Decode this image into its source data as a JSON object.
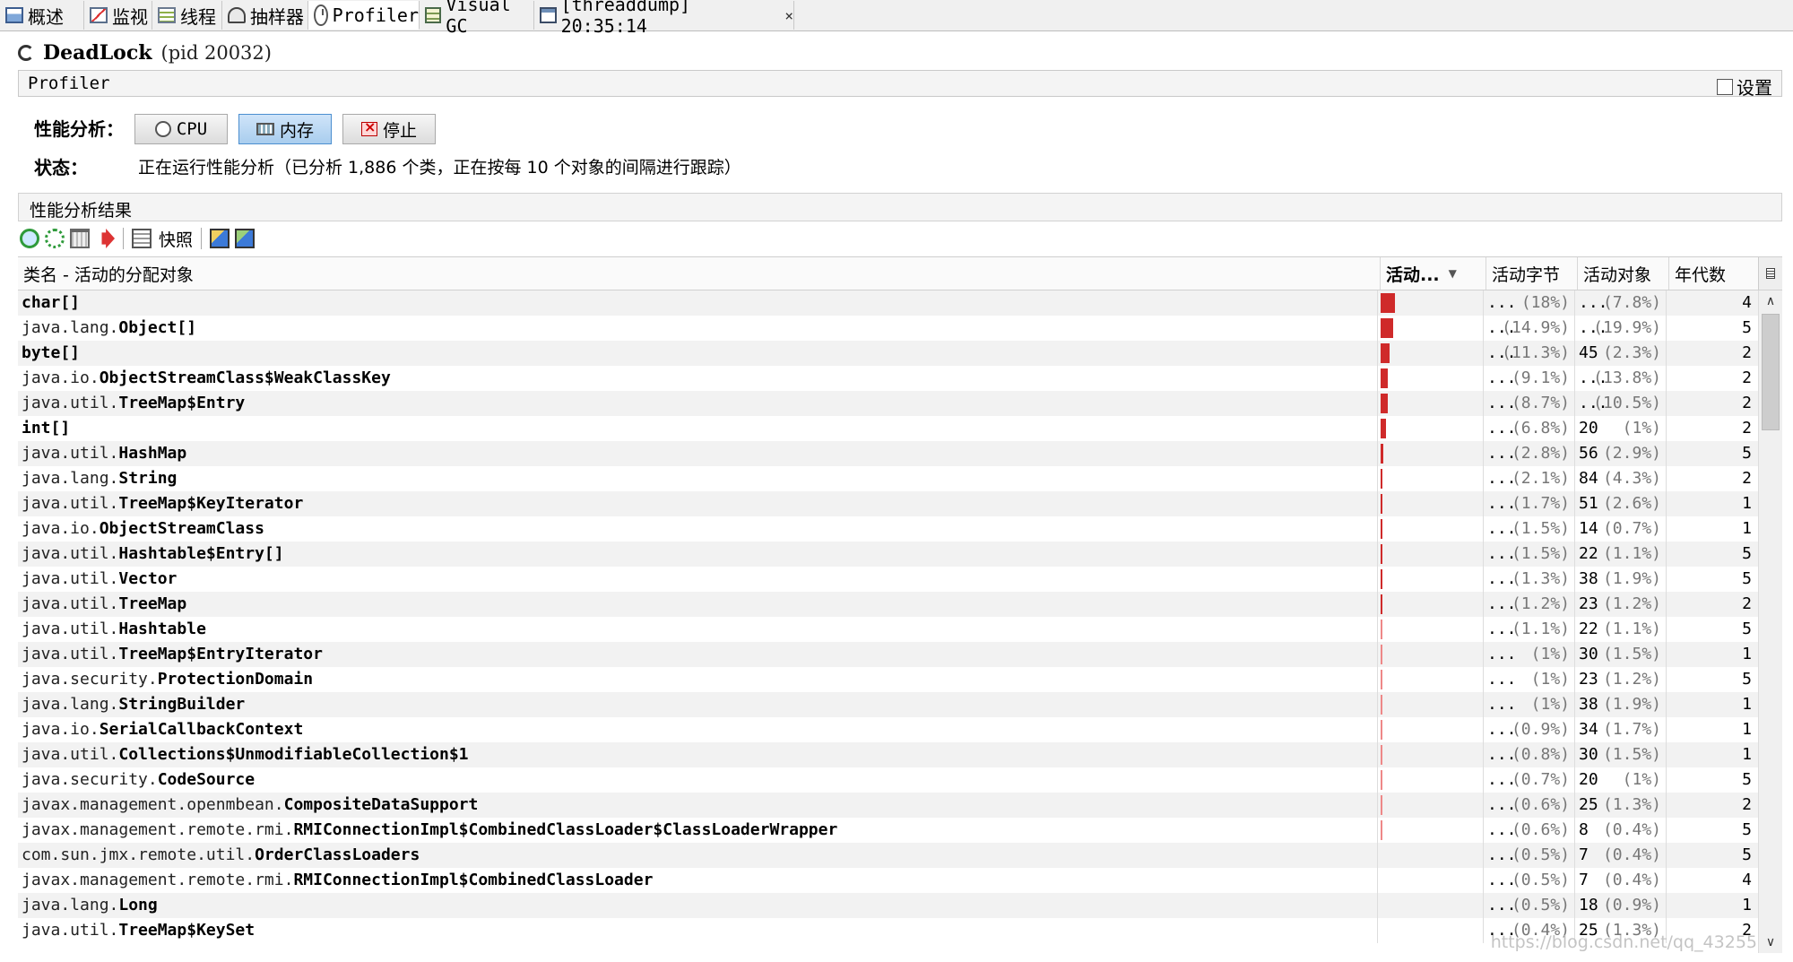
{
  "tabs": [
    {
      "label": "概述",
      "icon": "overview-icon"
    },
    {
      "label": "监视",
      "icon": "monitor-icon"
    },
    {
      "label": "线程",
      "icon": "threads-icon"
    },
    {
      "label": "抽样器",
      "icon": "sampler-icon"
    },
    {
      "label": "Profiler",
      "icon": "profiler-icon",
      "active": true
    },
    {
      "label": "Visual GC",
      "icon": "visual-gc-icon"
    },
    {
      "label": "[threaddump] 20:35:14",
      "icon": "threaddump-icon"
    }
  ],
  "tab_close": "×",
  "app": {
    "name": "DeadLock",
    "pid": "(pid 20032)"
  },
  "profiler_header": {
    "label": "Profiler",
    "settings_label": "设置"
  },
  "controls": {
    "perf_label": "性能分析：",
    "cpu_label": "CPU",
    "memory_label": "内存",
    "stop_label": "停止",
    "status_label": "状态：",
    "status_text": "正在运行性能分析（已分析 1,886 个类，正在按每 10 个对象的间隔进行跟踪）"
  },
  "results": {
    "label": "性能分析结果",
    "snapshot_label": "快照"
  },
  "table": {
    "headers": {
      "name": "类名 - 活动的分配对象",
      "live": "活动...",
      "live_bytes": "活动字节",
      "live_objects": "活动对象",
      "generations": "年代数"
    },
    "rows": [
      {
        "pkg": "",
        "cls": "char[]",
        "bar": 0.148,
        "bytes": "...",
        "bytes_pct": "(18%)",
        "objs": "...",
        "objs_pct": "(7.8%)",
        "gen": "4"
      },
      {
        "pkg": "java.lang.",
        "cls": "Object[]",
        "bar": 0.123,
        "bytes": "...",
        "bytes_pct": "(14.9%)",
        "objs": "...",
        "objs_pct": "(19.9%)",
        "gen": "5"
      },
      {
        "pkg": "",
        "cls": "byte[]",
        "bar": 0.093,
        "bytes": "...",
        "bytes_pct": "(11.3%)",
        "objs": "45",
        "objs_pct": "(2.3%)",
        "gen": "2"
      },
      {
        "pkg": "java.io.",
        "cls": "ObjectStreamClass$WeakClassKey",
        "bar": 0.075,
        "bytes": "...",
        "bytes_pct": "(9.1%)",
        "objs": "...",
        "objs_pct": "(13.8%)",
        "gen": "2"
      },
      {
        "pkg": "java.util.",
        "cls": "TreeMap$Entry",
        "bar": 0.072,
        "bytes": "...",
        "bytes_pct": "(8.7%)",
        "objs": "...",
        "objs_pct": "(10.5%)",
        "gen": "2"
      },
      {
        "pkg": "",
        "cls": "int[]",
        "bar": 0.056,
        "bytes": "...",
        "bytes_pct": "(6.8%)",
        "objs": "20",
        "objs_pct": "(1%)",
        "gen": "2"
      },
      {
        "pkg": "java.util.",
        "cls": "HashMap",
        "bar": 0.023,
        "bytes": "...",
        "bytes_pct": "(2.8%)",
        "objs": "56",
        "objs_pct": "(2.9%)",
        "gen": "5"
      },
      {
        "pkg": "java.lang.",
        "cls": "String",
        "bar": 0.017,
        "bytes": "...",
        "bytes_pct": "(2.1%)",
        "objs": "84",
        "objs_pct": "(4.3%)",
        "gen": "2"
      },
      {
        "pkg": "java.util.",
        "cls": "TreeMap$KeyIterator",
        "bar": 0.014,
        "bytes": "...",
        "bytes_pct": "(1.7%)",
        "objs": "51",
        "objs_pct": "(2.6%)",
        "gen": "1"
      },
      {
        "pkg": "java.io.",
        "cls": "ObjectStreamClass",
        "bar": 0.012,
        "bytes": "...",
        "bytes_pct": "(1.5%)",
        "objs": "14",
        "objs_pct": "(0.7%)",
        "gen": "1"
      },
      {
        "pkg": "java.util.",
        "cls": "Hashtable$Entry[]",
        "bar": 0.012,
        "bytes": "...",
        "bytes_pct": "(1.5%)",
        "objs": "22",
        "objs_pct": "(1.1%)",
        "gen": "5"
      },
      {
        "pkg": "java.util.",
        "cls": "Vector",
        "bar": 0.011,
        "bytes": "...",
        "bytes_pct": "(1.3%)",
        "objs": "38",
        "objs_pct": "(1.9%)",
        "gen": "5"
      },
      {
        "pkg": "java.util.",
        "cls": "TreeMap",
        "bar": 0.01,
        "bytes": "...",
        "bytes_pct": "(1.2%)",
        "objs": "23",
        "objs_pct": "(1.2%)",
        "gen": "2"
      },
      {
        "pkg": "java.util.",
        "cls": "Hashtable",
        "bar": 0.009,
        "bytes": "...",
        "bytes_pct": "(1.1%)",
        "objs": "22",
        "objs_pct": "(1.1%)",
        "gen": "5"
      },
      {
        "pkg": "java.util.",
        "cls": "TreeMap$EntryIterator",
        "bar": 0.008,
        "bytes": "...",
        "bytes_pct": "(1%)",
        "objs": "30",
        "objs_pct": "(1.5%)",
        "gen": "1"
      },
      {
        "pkg": "java.security.",
        "cls": "ProtectionDomain",
        "bar": 0.008,
        "bytes": "...",
        "bytes_pct": "(1%)",
        "objs": "23",
        "objs_pct": "(1.2%)",
        "gen": "5"
      },
      {
        "pkg": "java.lang.",
        "cls": "StringBuilder",
        "bar": 0.008,
        "bytes": "...",
        "bytes_pct": "(1%)",
        "objs": "38",
        "objs_pct": "(1.9%)",
        "gen": "1"
      },
      {
        "pkg": "java.io.",
        "cls": "SerialCallbackContext",
        "bar": 0.007,
        "bytes": "...",
        "bytes_pct": "(0.9%)",
        "objs": "34",
        "objs_pct": "(1.7%)",
        "gen": "1"
      },
      {
        "pkg": "java.util.",
        "cls": "Collections$UnmodifiableCollection$1",
        "bar": 0.007,
        "bytes": "...",
        "bytes_pct": "(0.8%)",
        "objs": "30",
        "objs_pct": "(1.5%)",
        "gen": "1"
      },
      {
        "pkg": "java.security.",
        "cls": "CodeSource",
        "bar": 0.006,
        "bytes": "...",
        "bytes_pct": "(0.7%)",
        "objs": "20",
        "objs_pct": "(1%)",
        "gen": "5"
      },
      {
        "pkg": "javax.management.openmbean.",
        "cls": "CompositeDataSupport",
        "bar": 0.005,
        "bytes": "...",
        "bytes_pct": "(0.6%)",
        "objs": "25",
        "objs_pct": "(1.3%)",
        "gen": "2"
      },
      {
        "pkg": "javax.management.remote.rmi.",
        "cls": "RMIConnectionImpl$CombinedClassLoader$ClassLoaderWrapper",
        "bar": 0.005,
        "bytes": "...",
        "bytes_pct": "(0.6%)",
        "objs": "8",
        "objs_pct": "(0.4%)",
        "gen": "5"
      },
      {
        "pkg": "com.sun.jmx.remote.util.",
        "cls": "OrderClassLoaders",
        "bar": 0.0,
        "bytes": "...",
        "bytes_pct": "(0.5%)",
        "objs": "7",
        "objs_pct": "(0.4%)",
        "gen": "5"
      },
      {
        "pkg": "javax.management.remote.rmi.",
        "cls": "RMIConnectionImpl$CombinedClassLoader",
        "bar": 0.0,
        "bytes": "...",
        "bytes_pct": "(0.5%)",
        "objs": "7",
        "objs_pct": "(0.4%)",
        "gen": "4"
      },
      {
        "pkg": "java.lang.",
        "cls": "Long",
        "bar": 0.0,
        "bytes": "...",
        "bytes_pct": "(0.5%)",
        "objs": "18",
        "objs_pct": "(0.9%)",
        "gen": "1"
      },
      {
        "pkg": "java.util.",
        "cls": "TreeMap$KeySet",
        "bar": 0.0,
        "bytes": "...",
        "bytes_pct": "(0.4%)",
        "objs": "25",
        "objs_pct": "(1.3%)",
        "gen": "2"
      }
    ]
  },
  "watermark": "https://blog.csdn.net/qq_43255"
}
